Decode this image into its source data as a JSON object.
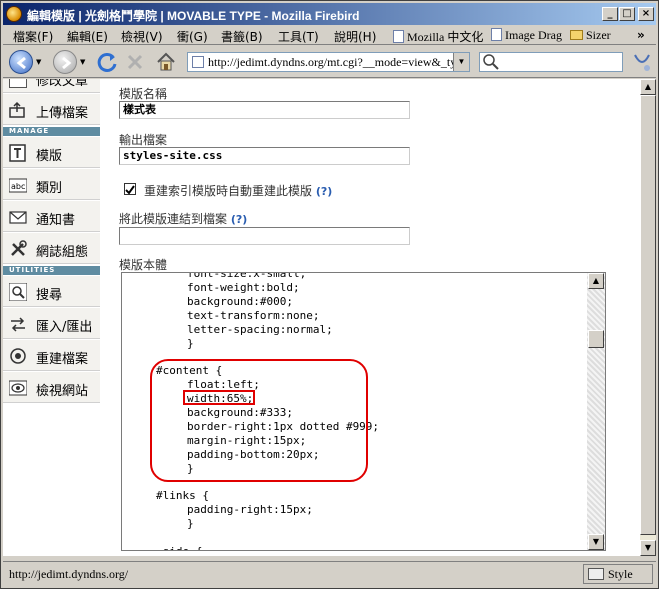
{
  "window": {
    "title": "編輯模版 | 光劍格鬥學院 | MOVABLE TYPE - Mozilla Firebird"
  },
  "menu": {
    "items": [
      "檔案(F)",
      "編輯(E)",
      "檢視(V)",
      "衝(G)",
      "書籤(B)",
      "工具(T)",
      "說明(H)"
    ],
    "personal_toolbar": [
      "Mozilla 中文化",
      "Image Drag",
      "Sizer"
    ],
    "overflow": "»"
  },
  "nav": {
    "url": "http://jedimt.dyndns.org/mt.cgi?__mode=view&_ty",
    "search_placeholder": ""
  },
  "sidebar": {
    "top_partial_label": "修改文章",
    "items_top": [
      {
        "label": "上傳檔案",
        "icon": "upload-icon"
      }
    ],
    "manage_header": "MANAGE",
    "manage": [
      {
        "label": "模版",
        "icon": "template-icon"
      },
      {
        "label": "類別",
        "icon": "category-icon"
      },
      {
        "label": "通知書",
        "icon": "envelope-icon"
      },
      {
        "label": "網誌組態",
        "icon": "tools-icon"
      }
    ],
    "utilities_header": "UTILITIES",
    "utilities": [
      {
        "label": "搜尋",
        "icon": "magnifier-icon"
      },
      {
        "label": "匯入/匯出",
        "icon": "import-export-icon"
      },
      {
        "label": "重建檔案",
        "icon": "rebuild-icon"
      },
      {
        "label": "檢視網站",
        "icon": "eye-icon"
      }
    ]
  },
  "form": {
    "template_name_label": "模版名稱",
    "template_name_value": "樣式表",
    "output_file_label": "輸出檔案",
    "output_file_value": "styles-site.css",
    "rebuild_checkbox_label": "重建索引模版時自動重建此模版",
    "rebuild_checked": true,
    "help_text": "(?)",
    "link_file_label": "將此模版連結到檔案",
    "link_file_value": "",
    "body_label": "模版本體",
    "code_lines": [
      {
        "indent": 2,
        "text": "font-size:x-small;"
      },
      {
        "indent": 2,
        "text": "font-weight:bold;"
      },
      {
        "indent": 2,
        "text": "background:#000;"
      },
      {
        "indent": 2,
        "text": "text-transform:none;"
      },
      {
        "indent": 2,
        "text": "letter-spacing:normal;"
      },
      {
        "indent": 2,
        "text": "}"
      },
      {
        "indent": 0,
        "text": ""
      },
      {
        "indent": 1,
        "text": "#content {"
      },
      {
        "indent": 2,
        "text": "float:left;"
      },
      {
        "indent": 2,
        "text": "width:65%;"
      },
      {
        "indent": 2,
        "text": "background:#333;"
      },
      {
        "indent": 2,
        "text": "border-right:1px dotted #999;"
      },
      {
        "indent": 2,
        "text": "margin-right:15px;"
      },
      {
        "indent": 2,
        "text": "padding-bottom:20px;"
      },
      {
        "indent": 2,
        "text": "}"
      },
      {
        "indent": 0,
        "text": ""
      },
      {
        "indent": 1,
        "text": "#links {"
      },
      {
        "indent": 2,
        "text": "padding-right:15px;"
      },
      {
        "indent": 2,
        "text": "}"
      },
      {
        "indent": 0,
        "text": ""
      },
      {
        "indent": 1,
        "text": ".side {"
      }
    ]
  },
  "status": {
    "text": "http://jedimt.dyndns.org/",
    "style_label": "Style"
  },
  "colors": {
    "highlight": "#e00000",
    "sidebar_header": "#5f8ca1",
    "link": "#2a5db0"
  }
}
